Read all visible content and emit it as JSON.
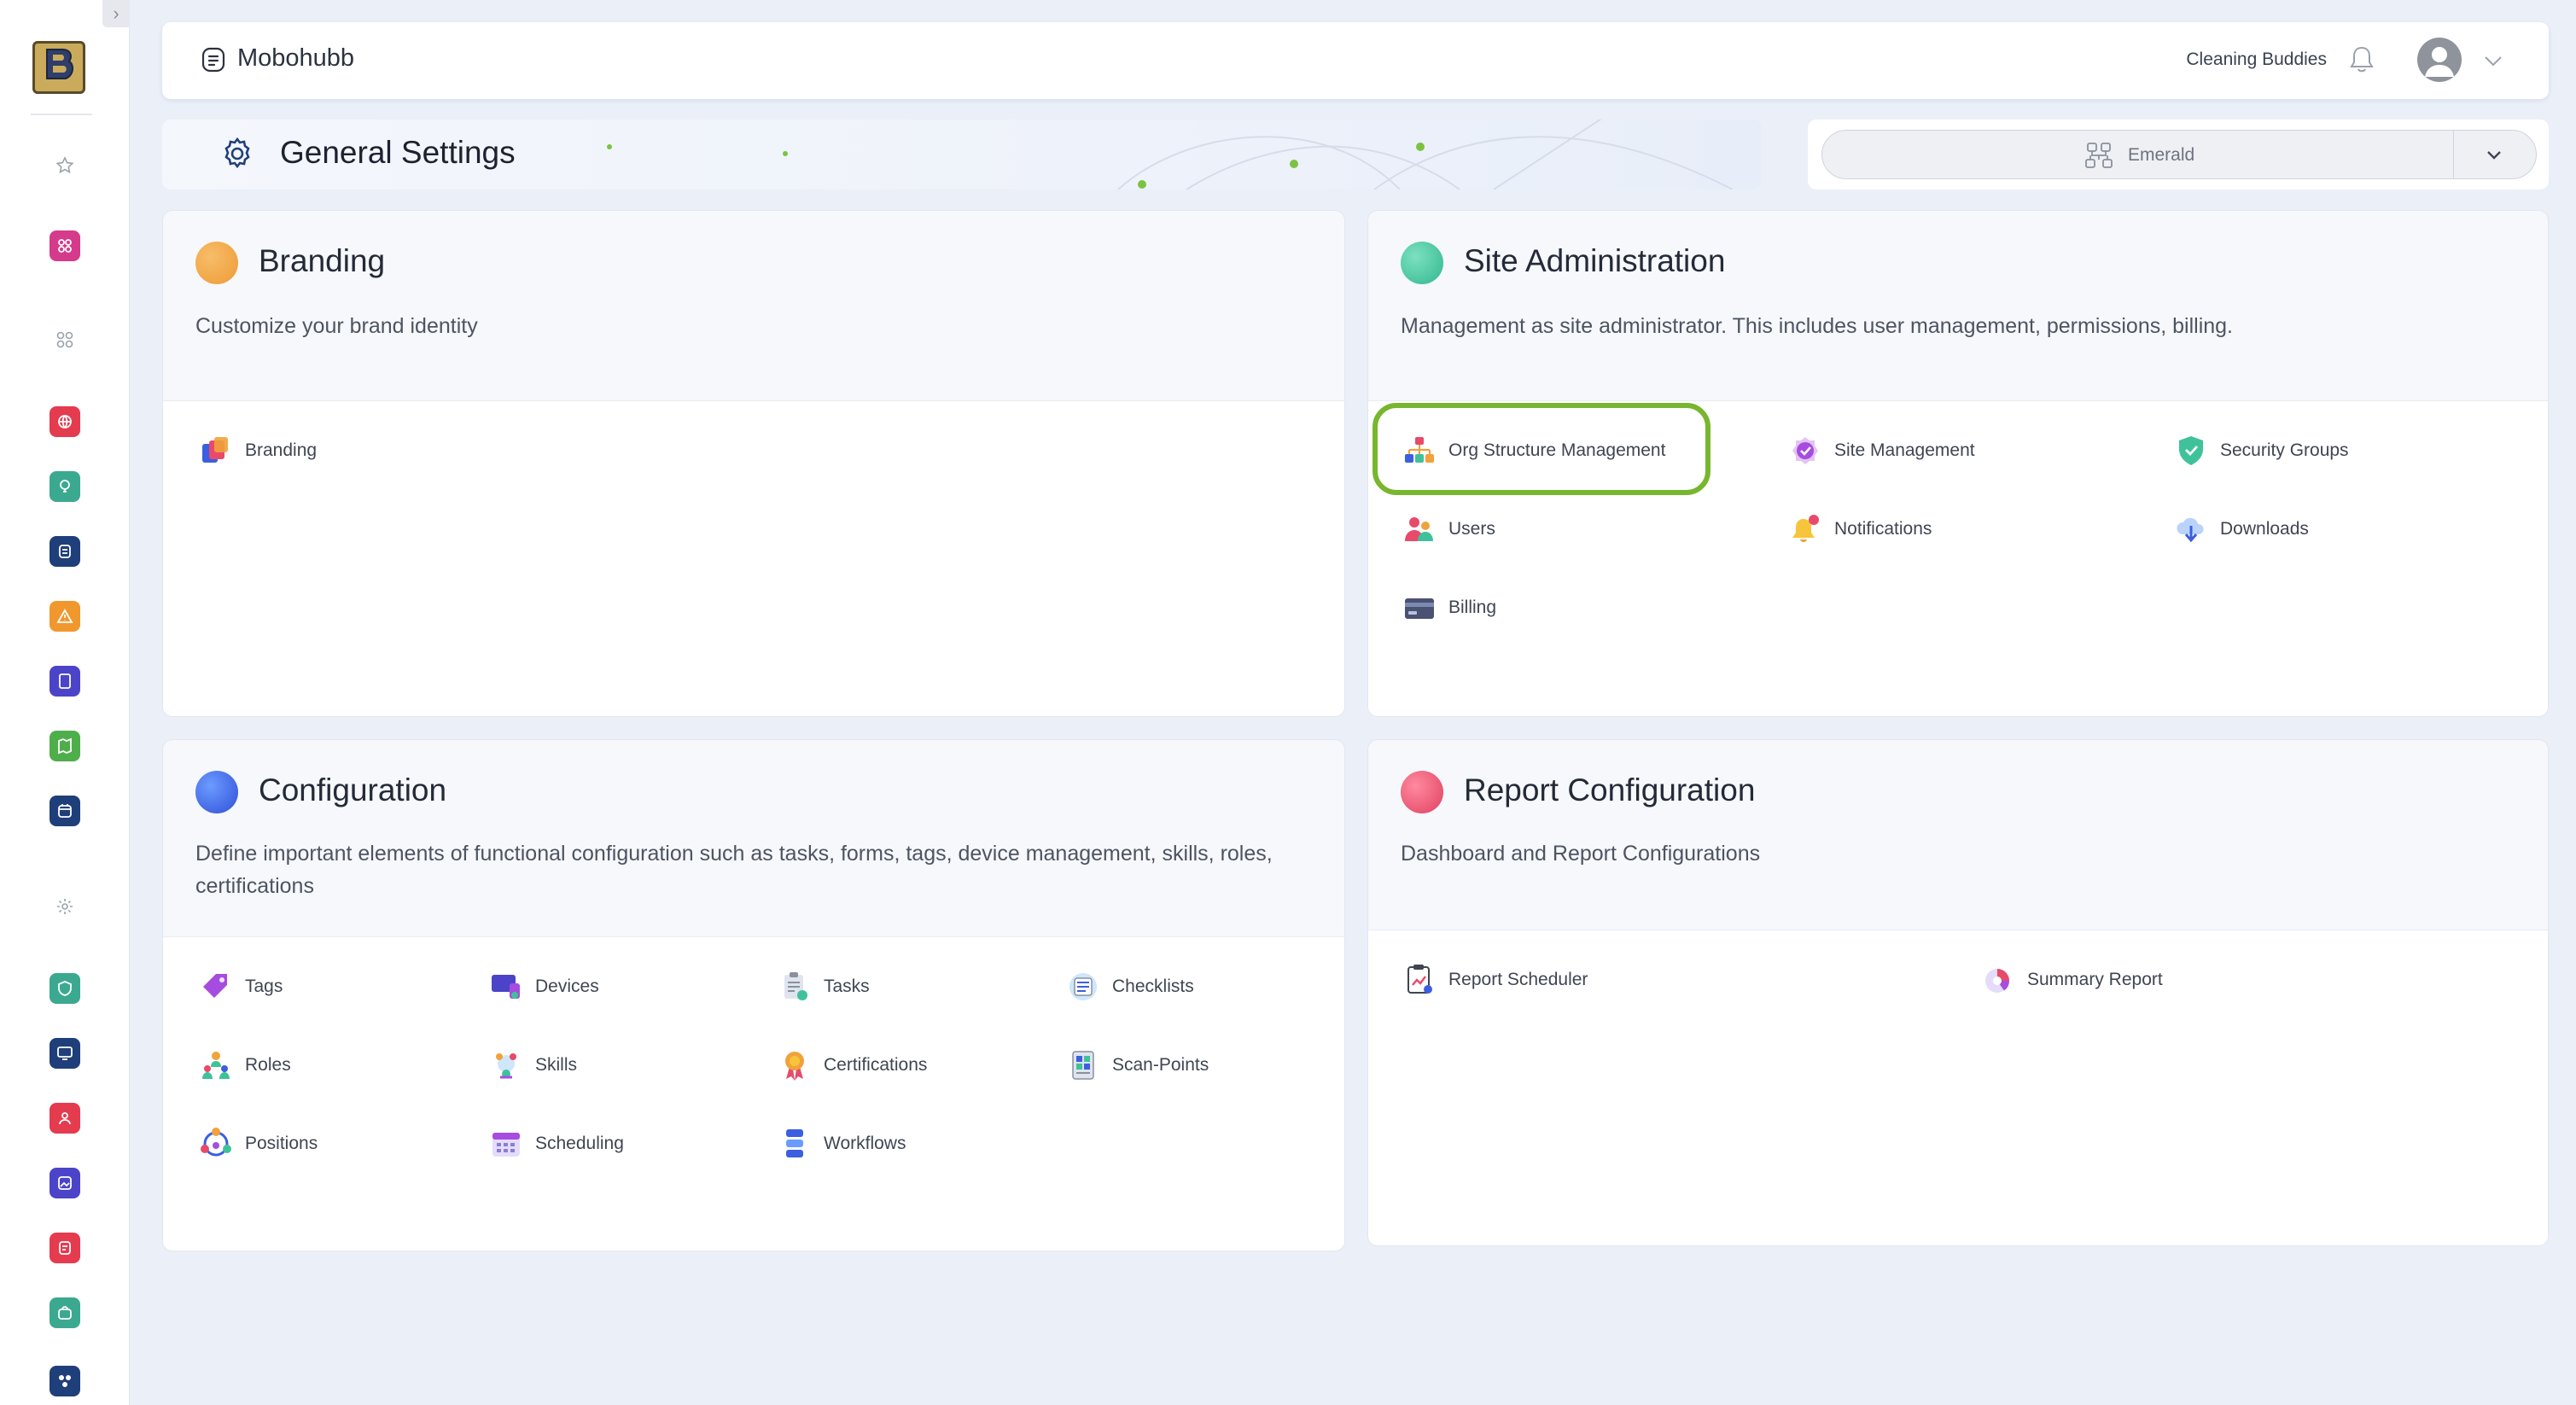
{
  "header": {
    "brand": "Mobohubb",
    "organization": "Cleaning Buddies"
  },
  "page": {
    "title": "General Settings"
  },
  "site_selector": {
    "selected": "Emerald"
  },
  "sidebar": {
    "icons": [
      "star-icon",
      "apps-grid-icon",
      "grid-icon",
      "globe-icon",
      "lightbulb-icon",
      "document-icon",
      "warning-icon",
      "tablet-icon",
      "map-icon",
      "calendar-icon",
      "gear-icon",
      "shield-icon",
      "monitor-icon",
      "users-icon",
      "image-icon",
      "form-icon",
      "bag-icon",
      "network-icon"
    ]
  },
  "cards": {
    "branding": {
      "title": "Branding",
      "description": "Customize your brand identity",
      "accent": "#f0a23b",
      "items": [
        {
          "label": "Branding",
          "icon": "palette-icon"
        }
      ]
    },
    "site_admin": {
      "title": "Site Administration",
      "description": "Management as site administrator. This includes user management, permissions, billing.",
      "accent": "#3fc29a",
      "items": [
        {
          "label": "Org Structure Management",
          "icon": "org-chart-icon"
        },
        {
          "label": "Site Management",
          "icon": "check-badge-icon"
        },
        {
          "label": "Security Groups",
          "icon": "shield-check-icon"
        },
        {
          "label": "Users",
          "icon": "users-icon"
        },
        {
          "label": "Notifications",
          "icon": "bell-icon"
        },
        {
          "label": "Downloads",
          "icon": "cloud-download-icon"
        },
        {
          "label": "Billing",
          "icon": "credit-card-icon"
        }
      ]
    },
    "configuration": {
      "title": "Configuration",
      "description": "Define important elements of functional configuration such as tasks, forms, tags, device management, skills, roles, certifications",
      "accent": "#3b5fe0",
      "items": [
        {
          "label": "Tags",
          "icon": "tag-icon"
        },
        {
          "label": "Devices",
          "icon": "devices-icon"
        },
        {
          "label": "Tasks",
          "icon": "clipboard-icon"
        },
        {
          "label": "Checklists",
          "icon": "checklist-icon"
        },
        {
          "label": "Roles",
          "icon": "roles-icon"
        },
        {
          "label": "Skills",
          "icon": "skills-icon"
        },
        {
          "label": "Certifications",
          "icon": "award-icon"
        },
        {
          "label": "Scan-Points",
          "icon": "qr-icon"
        },
        {
          "label": "Positions",
          "icon": "positions-icon"
        },
        {
          "label": "Scheduling",
          "icon": "calendar-icon"
        },
        {
          "label": "Workflows",
          "icon": "workflow-icon"
        }
      ]
    },
    "reports": {
      "title": "Report Configuration",
      "description": "Dashboard and Report Configurations",
      "accent": "#e84a6a",
      "items": [
        {
          "label": "Report Scheduler",
          "icon": "report-clipboard-icon"
        },
        {
          "label": "Summary Report",
          "icon": "pie-chart-icon"
        }
      ]
    }
  }
}
